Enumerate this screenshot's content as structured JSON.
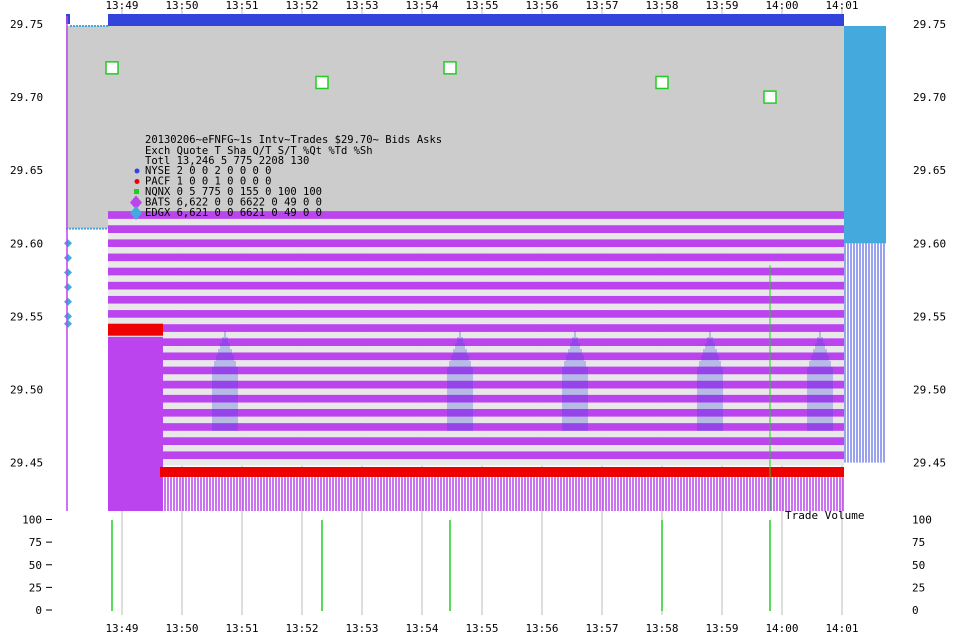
{
  "chart_data": {
    "type": "scatter",
    "title": "20130206~eFNFG~1s Intv~Trades $29.70~ Bids  Asks",
    "x_ticks": [
      "13:49",
      "13:50",
      "13:51",
      "13:52",
      "13:53",
      "13:54",
      "13:55",
      "13:56",
      "13:57",
      "13:58",
      "13:59",
      "14:00",
      "14:01"
    ],
    "price_ticks": [
      "29.75",
      "29.70",
      "29.65",
      "29.60",
      "29.55",
      "29.50",
      "29.45"
    ],
    "price_range": [
      29.44,
      29.76
    ],
    "volume_ticks": [
      "100",
      "75",
      "50",
      "25",
      "0"
    ],
    "volume_range": [
      0,
      100
    ],
    "volume_label": "Trade Volume",
    "legend": {
      "header": [
        "Exch",
        "Quote",
        "T",
        "Sha",
        "Q/T",
        "S/T",
        "%Qt",
        "%Td",
        "%Sh"
      ],
      "total": [
        "Totl",
        "13,246",
        "5",
        "775",
        "2208",
        "130",
        "",
        "",
        ""
      ],
      "rows": [
        {
          "exch": "NYSE",
          "marker": "dot",
          "color": "#3344dd",
          "values": [
            "2",
            "0",
            "0",
            "2",
            "0",
            "0",
            "0",
            "0"
          ]
        },
        {
          "exch": "PACF",
          "marker": "dot",
          "color": "#ee0000",
          "values": [
            "1",
            "0",
            "0",
            "1",
            "0",
            "0",
            "0",
            "0"
          ]
        },
        {
          "exch": "NQNX",
          "marker": "square",
          "color": "#22cc22",
          "values": [
            "0",
            "5",
            "775",
            "0",
            "155",
            "0",
            "100",
            "100"
          ]
        },
        {
          "exch": "BATS",
          "marker": "diamond",
          "color": "#bb44ee",
          "values": [
            "6,622",
            "0",
            "0",
            "6622",
            "0",
            "49",
            "0",
            "0"
          ]
        },
        {
          "exch": "EDGX",
          "marker": "diamond",
          "color": "#44aadd",
          "values": [
            "6,621",
            "0",
            "0",
            "6621",
            "0",
            "49",
            "0",
            "0"
          ]
        }
      ]
    },
    "trades": [
      {
        "time": "13:48:50",
        "price": 29.72
      },
      {
        "time": "13:52:20",
        "price": 29.71
      },
      {
        "time": "13:54:28",
        "price": 29.72
      },
      {
        "time": "13:58:00",
        "price": 29.71
      },
      {
        "time": "13:59:48",
        "price": 29.7
      }
    ],
    "trade_volumes_time": [
      "13:48:50",
      "13:52:20",
      "13:54:28",
      "13:58:00",
      "13:59:48"
    ],
    "best_ask": 29.75,
    "best_bid": 29.44,
    "colors": {
      "nyse": "#3344dd",
      "pacf": "#ee0000",
      "nqnx": "#22cc22",
      "bats": "#bb44ee",
      "edgx": "#44aadd",
      "quote_fill": "#cccccc",
      "gridline": "#bbbbbb"
    }
  }
}
